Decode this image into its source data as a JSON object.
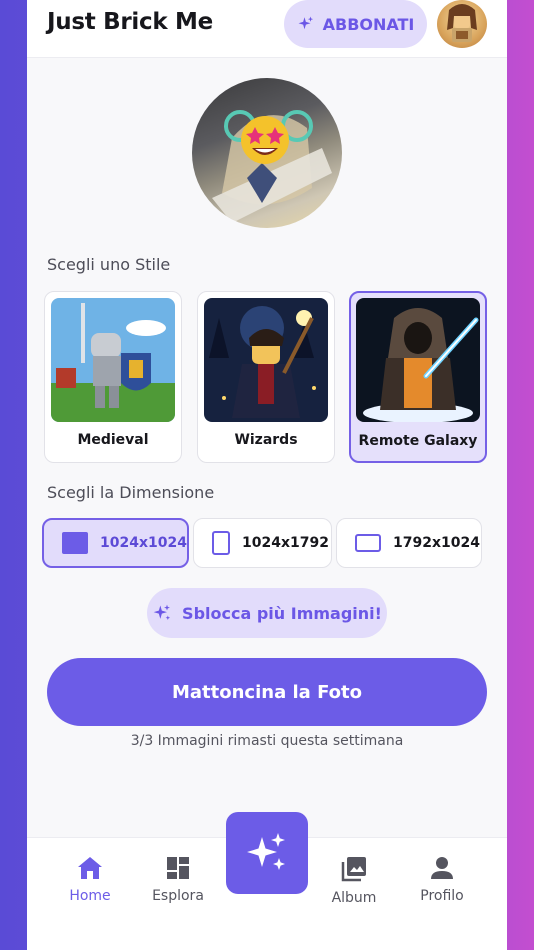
{
  "header": {
    "app_title": "Just Brick Me",
    "subscribe_label": "ABBONATI"
  },
  "style_section": {
    "label": "Scegli uno Stile",
    "styles": [
      {
        "name": "Medieval",
        "selected": false
      },
      {
        "name": "Wizards",
        "selected": false
      },
      {
        "name": "Remote Galaxy",
        "selected": true
      }
    ]
  },
  "size_section": {
    "label": "Scegli la Dimensione",
    "sizes": [
      {
        "label": "1024x1024",
        "selected": true,
        "icon": "square-icon"
      },
      {
        "label": "1024x1792",
        "selected": false,
        "icon": "portrait-icon"
      },
      {
        "label": "1792x1024",
        "selected": false,
        "icon": "landscape-icon"
      }
    ]
  },
  "unlock_label": "Sblocca più Immagini!",
  "main_action_label": "Mattoncina la Foto",
  "quota_text": "3/3 Immagini rimasti questa settimana",
  "nav": {
    "items": [
      {
        "label": "Home",
        "icon": "home-icon",
        "active": true
      },
      {
        "label": "Esplora",
        "icon": "grid-icon",
        "active": false
      },
      {
        "label": "Album",
        "icon": "album-icon",
        "active": false
      },
      {
        "label": "Profilo",
        "icon": "person-icon",
        "active": false
      }
    ],
    "center_icon": "sparkles-icon"
  },
  "colors": {
    "accent": "#6c5ce7",
    "accent_light": "#e2dcfb",
    "text": "#17171c",
    "muted": "#55555f"
  }
}
